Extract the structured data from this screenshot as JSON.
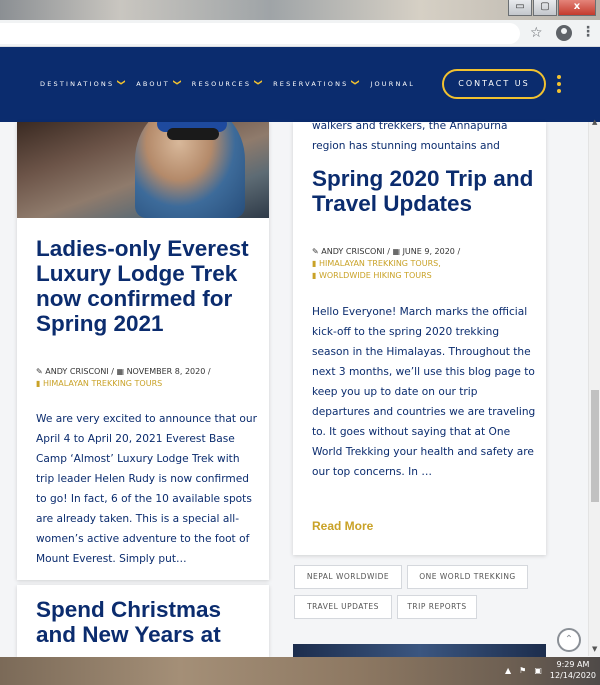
{
  "window": {
    "controls": {
      "minimize": "▭",
      "maximize": "▢",
      "close": "x"
    }
  },
  "browser": {
    "star": "☆",
    "menu": "⋮"
  },
  "nav": {
    "items": [
      {
        "label": "DESTINATIONS",
        "has_dropdown": true
      },
      {
        "label": "ABOUT",
        "has_dropdown": true
      },
      {
        "label": "RESOURCES",
        "has_dropdown": true
      },
      {
        "label": "RESERVATIONS",
        "has_dropdown": true
      },
      {
        "label": "JOURNAL",
        "has_dropdown": false
      }
    ],
    "chevron": "❯",
    "contact": "CONTACT US",
    "colors": {
      "header_bg": "#0b2c6e",
      "accent": "#f2c230"
    }
  },
  "post1": {
    "title": "Ladies-only Everest Luxury Lodge Trek now confirmed for Spring 2021",
    "author": "ANDY CRISCONI",
    "date": "NOVEMBER 8, 2020",
    "category": "HIMALAYAN TREKKING TOURS",
    "excerpt": "We are very excited to announce that our April 4 to April 20, 2021 Everest Base Camp ‘Almost’ Luxury Lodge Trek with trip leader Helen Rudy is now confirmed to go! In fact, 6 of the 10 available spots are already taken. This is a special all-women’s active adventure to the foot of Mount Everest. Simply put…"
  },
  "post2": {
    "intro": "walkers and trekkers, the Annapurna region has stunning mountains and",
    "title": "Spring 2020 Trip and Travel Updates",
    "author": "ANDY CRISCONI",
    "date": "JUNE 9, 2020",
    "category1": "HIMALAYAN TREKKING TOURS",
    "category2": "WORLDWIDE HIKING TOURS",
    "excerpt": "Hello Everyone! March marks the official kick-off to the spring 2020 trekking season in the Himalayas. Throughout the next 3 months, we’ll use this blog page to keep you up to date on our trip departures and countries we are traveling to. It goes without saying that at One World Trekking your health and safety are our top concerns. In …",
    "read_more": "Read More"
  },
  "post3": {
    "title": "Spend Christmas and New Years at"
  },
  "tags": [
    "NEPAL WORLDWIDE",
    "ONE WORLD TREKKING",
    "TRAVEL UPDATES",
    "TRIP REPORTS"
  ],
  "taskbar": {
    "time": "9:29 AM",
    "date": "12/14/2020"
  }
}
